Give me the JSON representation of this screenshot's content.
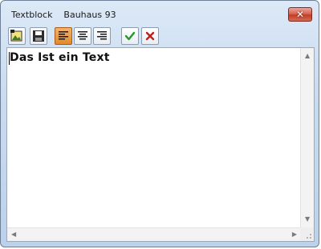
{
  "window": {
    "title": "Textblock    Bauhaus 93",
    "close_glyph": "✕"
  },
  "toolbar": {
    "buttons": [
      {
        "name": "insert-image-icon"
      },
      {
        "name": "save-icon"
      },
      {
        "name": "align-left-icon",
        "active": true
      },
      {
        "name": "align-center-icon"
      },
      {
        "name": "align-right-icon"
      },
      {
        "name": "confirm-check-icon"
      },
      {
        "name": "cancel-x-icon"
      }
    ]
  },
  "editor": {
    "text": "Das Ist ein Text"
  },
  "colors": {
    "active_button": "#e48a2a",
    "confirm_green": "#1f9a1f",
    "cancel_red": "#c0201a",
    "close_button": "#c84a36"
  }
}
